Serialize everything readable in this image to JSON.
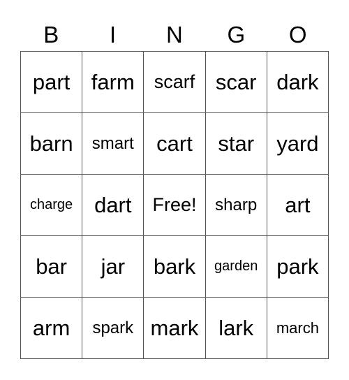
{
  "header": [
    "B",
    "I",
    "N",
    "G",
    "O"
  ],
  "cells": [
    [
      "part",
      "farm",
      "scarf",
      "scar",
      "dark"
    ],
    [
      "barn",
      "smart",
      "cart",
      "star",
      "yard"
    ],
    [
      "charge",
      "dart",
      "Free!",
      "sharp",
      "art"
    ],
    [
      "bar",
      "jar",
      "bark",
      "garden",
      "park"
    ],
    [
      "arm",
      "spark",
      "mark",
      "lark",
      "march"
    ]
  ]
}
